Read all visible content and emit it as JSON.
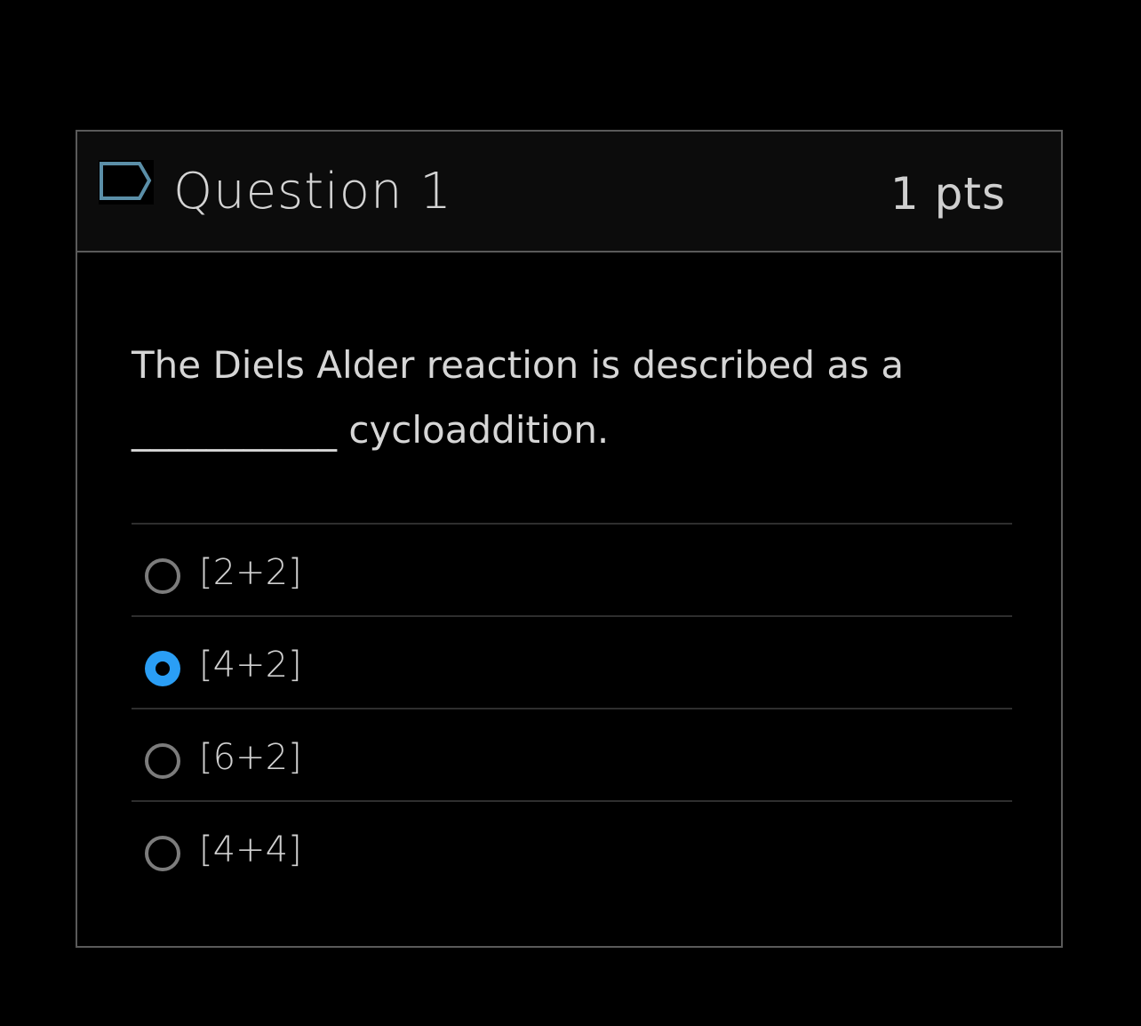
{
  "question": {
    "title": "Question 1",
    "points": "1 pts",
    "text_line1": "The Diels Alder reaction is described as a",
    "text_line2": "___________ cycloaddition.",
    "flag_icon": "flag-outline-icon",
    "flag_color": "#5b8fa8"
  },
  "answers": [
    {
      "label": "[2+2]",
      "selected": false
    },
    {
      "label": "[4+2]",
      "selected": true
    },
    {
      "label": "[6+2]",
      "selected": false
    },
    {
      "label": "[4+4]",
      "selected": false
    }
  ],
  "colors": {
    "radio_selected": "#2a9ef5",
    "radio_unselected": "#7c7c7c",
    "border": "#5a5a5a"
  }
}
